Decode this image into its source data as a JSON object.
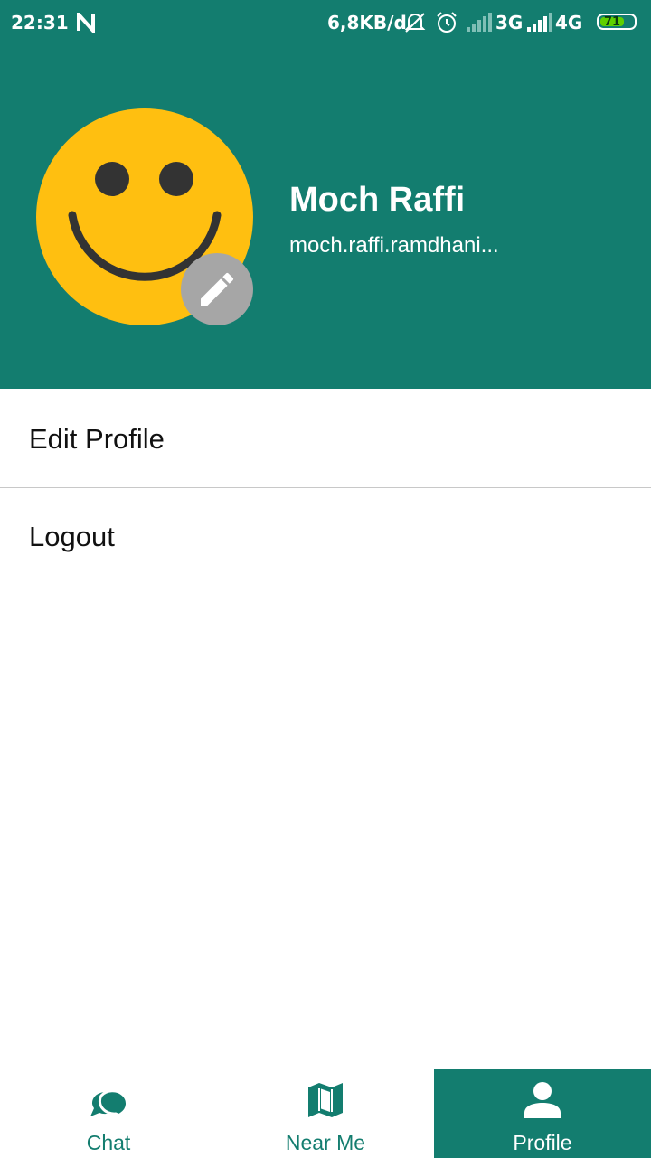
{
  "status_bar": {
    "time": "22:31",
    "network_speed": "6,8KB/d",
    "network_1": "3G",
    "network_2": "4G",
    "battery": "71"
  },
  "profile": {
    "name": "Moch Raffi",
    "email": "moch.raffi.ramdhani..."
  },
  "menu": {
    "items": [
      {
        "label": "Edit Profile"
      },
      {
        "label": "Logout"
      }
    ]
  },
  "bottom_nav": {
    "items": [
      {
        "label": "Chat",
        "icon": "chat-bubbles-icon"
      },
      {
        "label": "Near Me",
        "icon": "map-icon"
      },
      {
        "label": "Profile",
        "icon": "person-icon",
        "active": true
      }
    ]
  },
  "colors": {
    "primary": "#137d6f",
    "avatar_yellow": "#ffbf10",
    "edit_badge": "#a6a6a6"
  },
  "battery_level": 0.71
}
